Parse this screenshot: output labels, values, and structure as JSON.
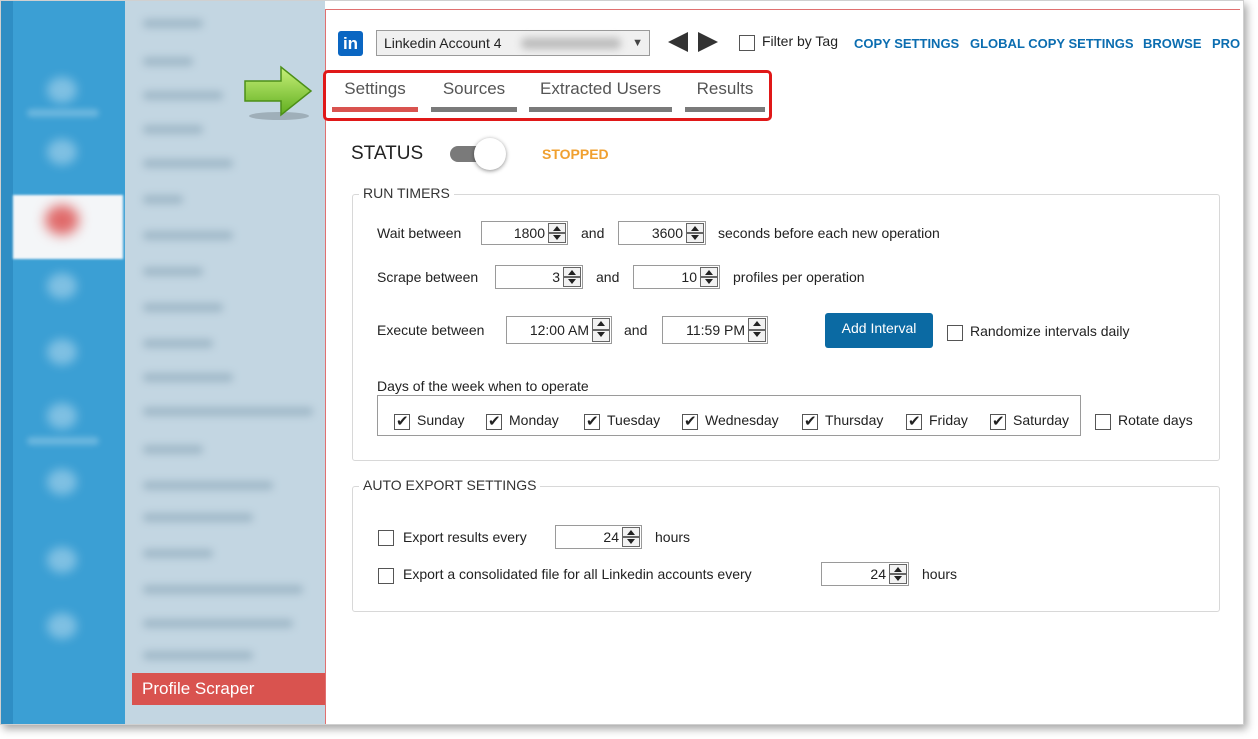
{
  "account": {
    "selected": "Linkedin Account 4",
    "icon": "linkedin-icon",
    "icon_text": "in"
  },
  "toolbar": {
    "filter_label": "Filter by Tag",
    "links": [
      "COPY SETTINGS",
      "GLOBAL COPY SETTINGS",
      "BROWSE",
      "PRO"
    ]
  },
  "tabs": [
    {
      "label": "Settings",
      "active": true
    },
    {
      "label": "Sources",
      "active": false
    },
    {
      "label": "Extracted Users",
      "active": false
    },
    {
      "label": "Results",
      "active": false
    }
  ],
  "sidebar": {
    "selected_item": "Profile Scraper"
  },
  "status": {
    "label": "STATUS",
    "value": "STOPPED",
    "value_color": "#f0a030"
  },
  "run_timers": {
    "title": "RUN TIMERS",
    "wait": {
      "label": "Wait between",
      "min": "1800",
      "and": "and",
      "max": "3600",
      "suffix": "seconds before each new operation"
    },
    "scrape": {
      "label": "Scrape between",
      "min": "3",
      "and": "and",
      "max": "10",
      "suffix": "profiles per operation"
    },
    "execute": {
      "label": "Execute between",
      "start": "12:00 AM",
      "and": "and",
      "end": "11:59 PM"
    },
    "add_interval_label": "Add Interval",
    "randomize_label": "Randomize intervals daily",
    "days_label": "Days of the week when to operate",
    "days": [
      {
        "label": "Sunday",
        "checked": true
      },
      {
        "label": "Monday",
        "checked": true
      },
      {
        "label": "Tuesday",
        "checked": true
      },
      {
        "label": "Wednesday",
        "checked": true
      },
      {
        "label": "Thursday",
        "checked": true
      },
      {
        "label": "Friday",
        "checked": true
      },
      {
        "label": "Saturday",
        "checked": true
      }
    ],
    "rotate_label": "Rotate days"
  },
  "auto_export": {
    "title": "AUTO EXPORT SETTINGS",
    "export_results": {
      "label": "Export results every",
      "value": "24",
      "suffix": "hours"
    },
    "export_consolidated": {
      "label": "Export a consolidated file for all Linkedin accounts every",
      "value": "24",
      "suffix": "hours"
    }
  },
  "colors": {
    "accent": "#0b6aa3",
    "active_tab": "#d9534f",
    "nav_blue": "#3b9fd4",
    "highlight": "#e01818"
  }
}
